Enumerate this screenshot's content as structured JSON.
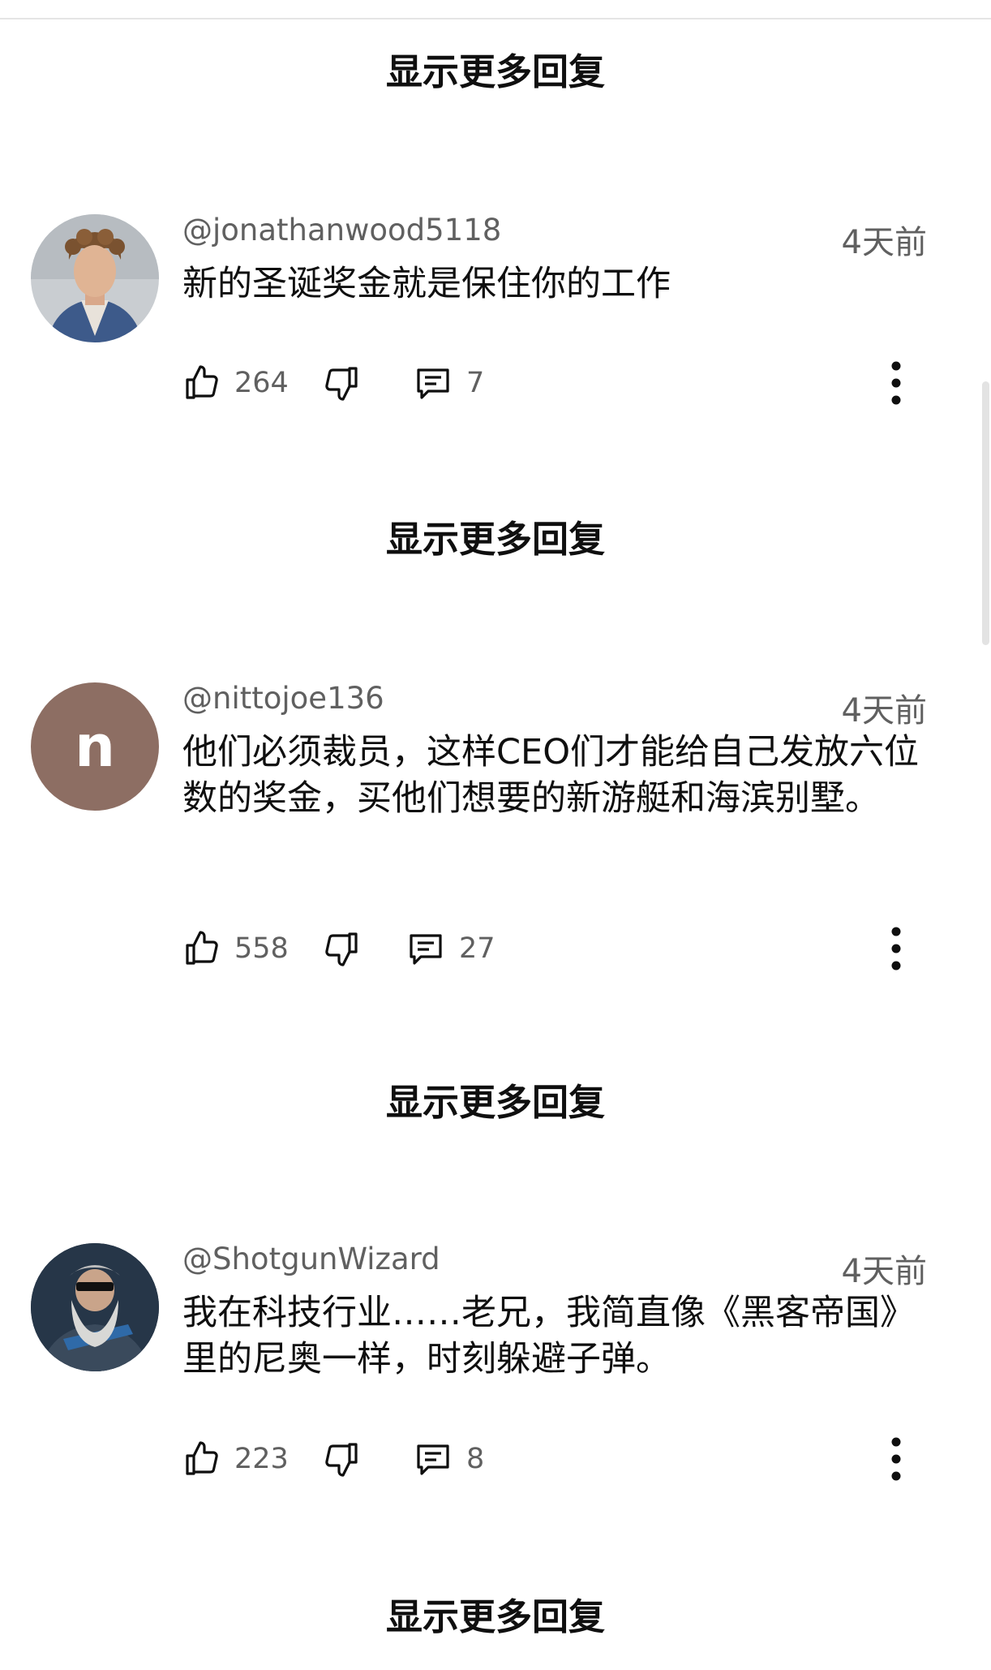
{
  "show_more_label": "显示更多回复",
  "comments": [
    {
      "handle": "@jonathanwood5118",
      "time": "4天前",
      "text": "新的圣诞奖金就是保住你的工作",
      "likes": "264",
      "replies": "7",
      "avatar": "photo-curly-hair-man"
    },
    {
      "handle": "@nittojoe136",
      "time": "4天前",
      "text": "他们必须裁员，这样CEO们才能给自己发放六位数的奖金，买他们想要的新游艇和海滨别墅。",
      "likes": "558",
      "replies": "27",
      "avatar_letter": "n",
      "avatar_color": "#8d6e63"
    },
    {
      "handle": "@ShotgunWizard",
      "time": "4天前",
      "text": "我在科技行业……老兄，我简直像《黑客帝国》里的尼奥一样，时刻躲避子弹。",
      "likes": "223",
      "replies": "8",
      "avatar": "photo-wizard-with-gun"
    }
  ],
  "icons": {
    "like": "thumbs-up-icon",
    "dislike": "thumbs-down-icon",
    "reply": "comment-icon",
    "menu": "more-vert-icon"
  }
}
